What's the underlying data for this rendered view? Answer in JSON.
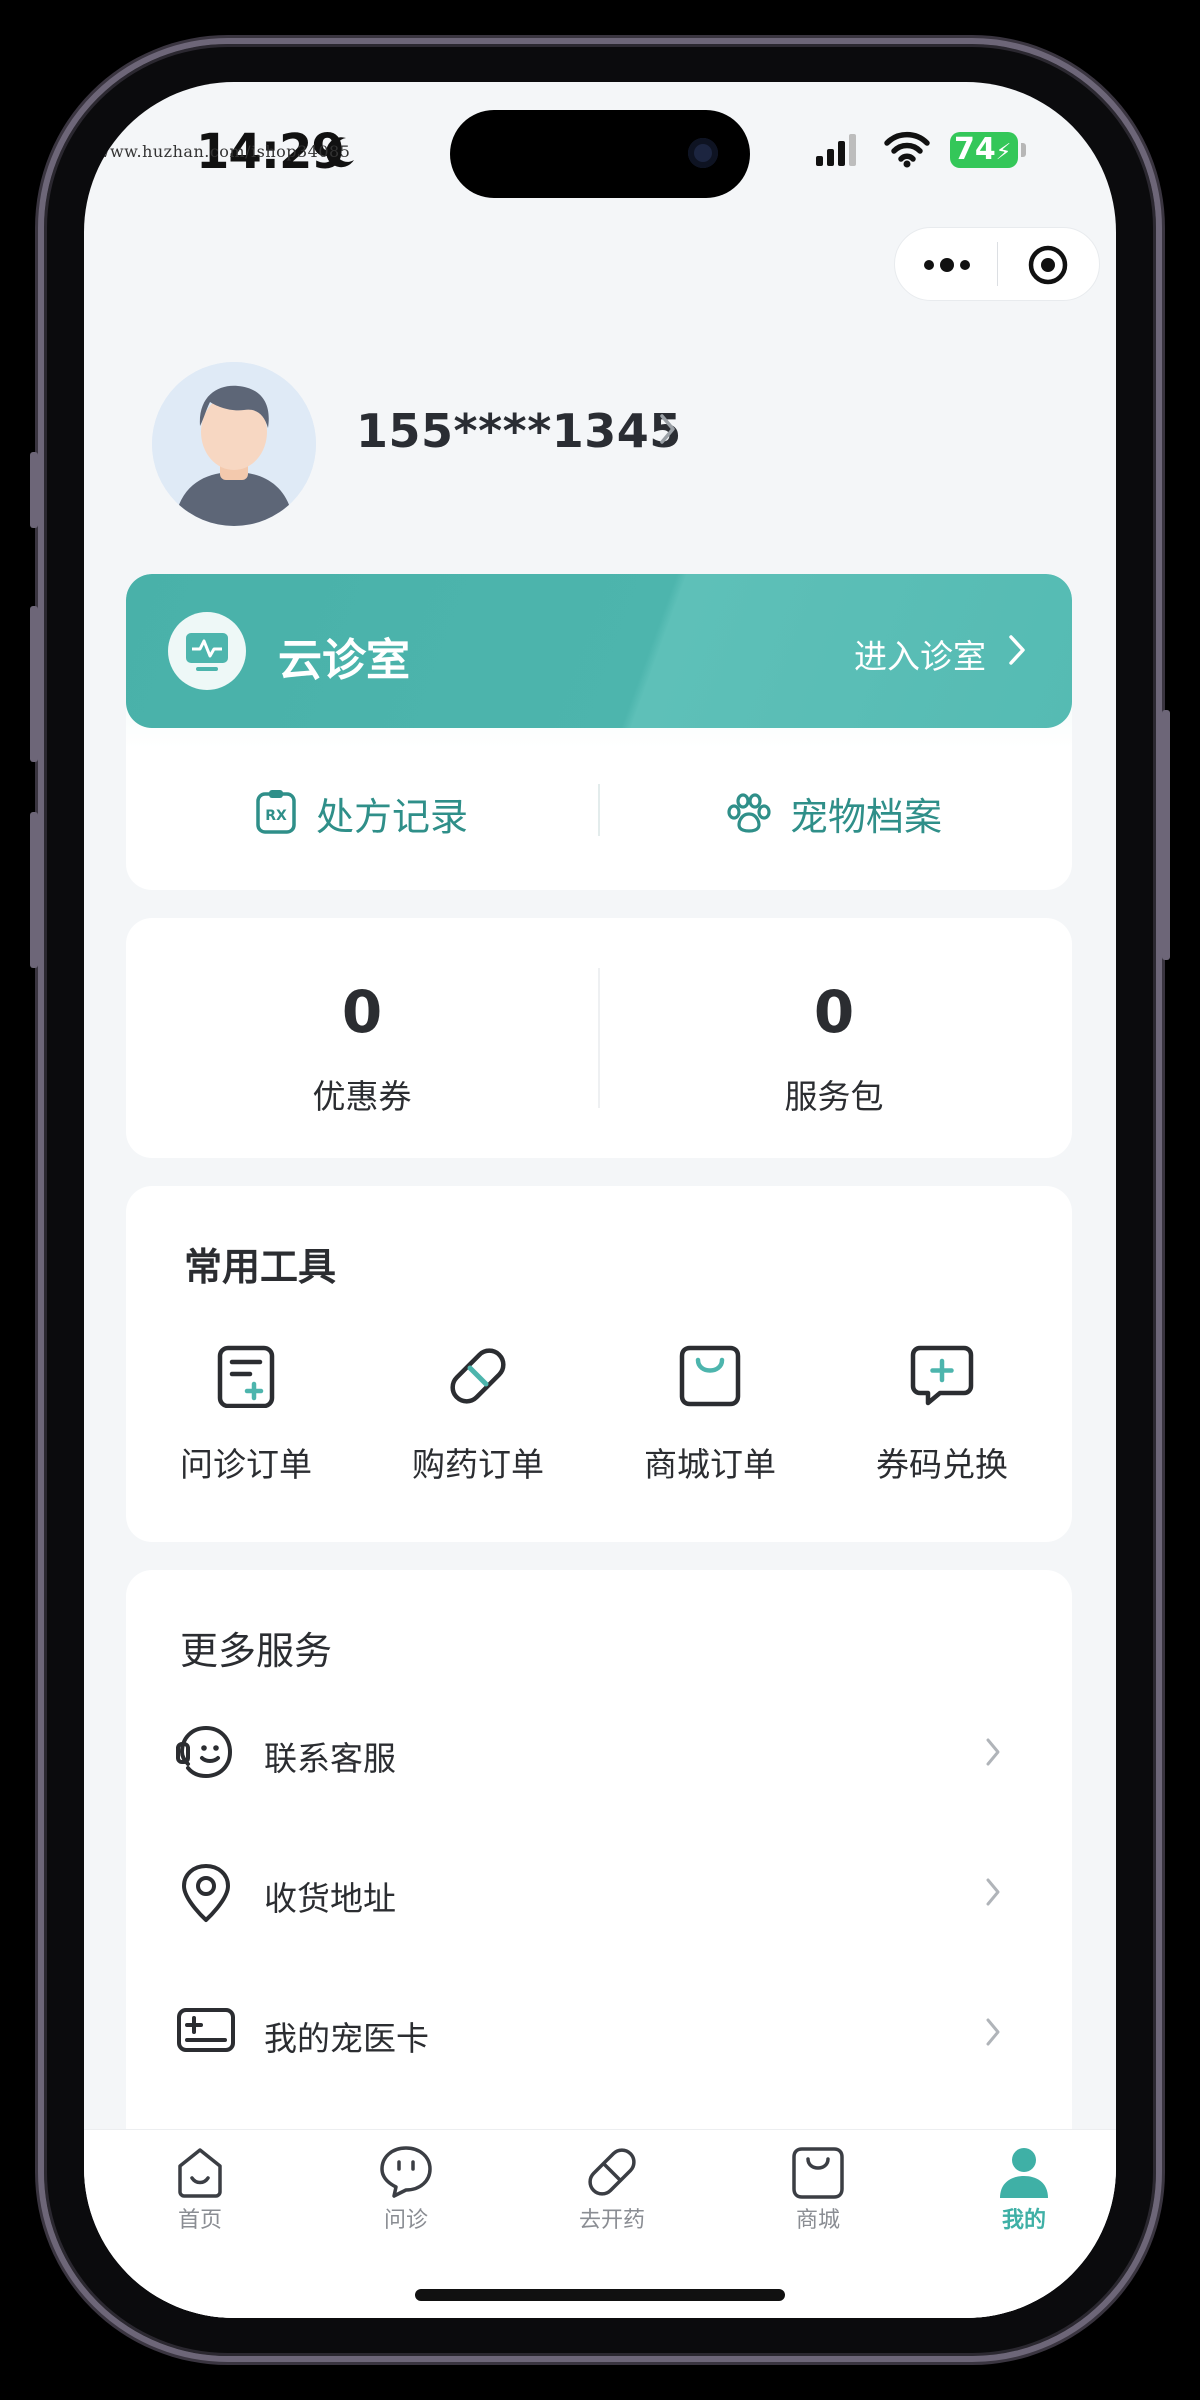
{
  "status_bar": {
    "time": "14:29",
    "battery": "74",
    "watermark": "https://www.huzhan.com/ishop34085"
  },
  "profile": {
    "phone": "155****1345"
  },
  "clinic": {
    "title": "云诊室",
    "enter_label": "进入诊室",
    "links": [
      "处方记录",
      "宠物档案"
    ]
  },
  "stats": [
    {
      "value": "0",
      "label": "优惠券"
    },
    {
      "value": "0",
      "label": "服务包"
    }
  ],
  "tools": {
    "title": "常用工具",
    "items": [
      {
        "label": "问诊订单",
        "icon": "consult-order-icon"
      },
      {
        "label": "购药订单",
        "icon": "pill-order-icon"
      },
      {
        "label": "商城订单",
        "icon": "shop-bag-icon"
      },
      {
        "label": "券码兑换",
        "icon": "coupon-exchange-icon"
      }
    ]
  },
  "more_services": {
    "title": "更多服务",
    "items": [
      {
        "label": "联系客服",
        "icon": "customer-service-icon"
      },
      {
        "label": "收货地址",
        "icon": "location-pin-icon"
      },
      {
        "label": "我的宠医卡",
        "icon": "pet-card-icon"
      }
    ]
  },
  "tabbar": {
    "items": [
      {
        "label": "首页",
        "icon": "home-icon"
      },
      {
        "label": "问诊",
        "icon": "chat-bubble-icon"
      },
      {
        "label": "去开药",
        "icon": "pill-icon"
      },
      {
        "label": "商城",
        "icon": "bag-icon"
      },
      {
        "label": "我的",
        "icon": "user-icon"
      }
    ],
    "active": "我的"
  },
  "colors": {
    "accent": "#4db5ad",
    "accent_text": "#2f8f89",
    "text": "#2b2d31",
    "background": "#f4f6f8"
  }
}
